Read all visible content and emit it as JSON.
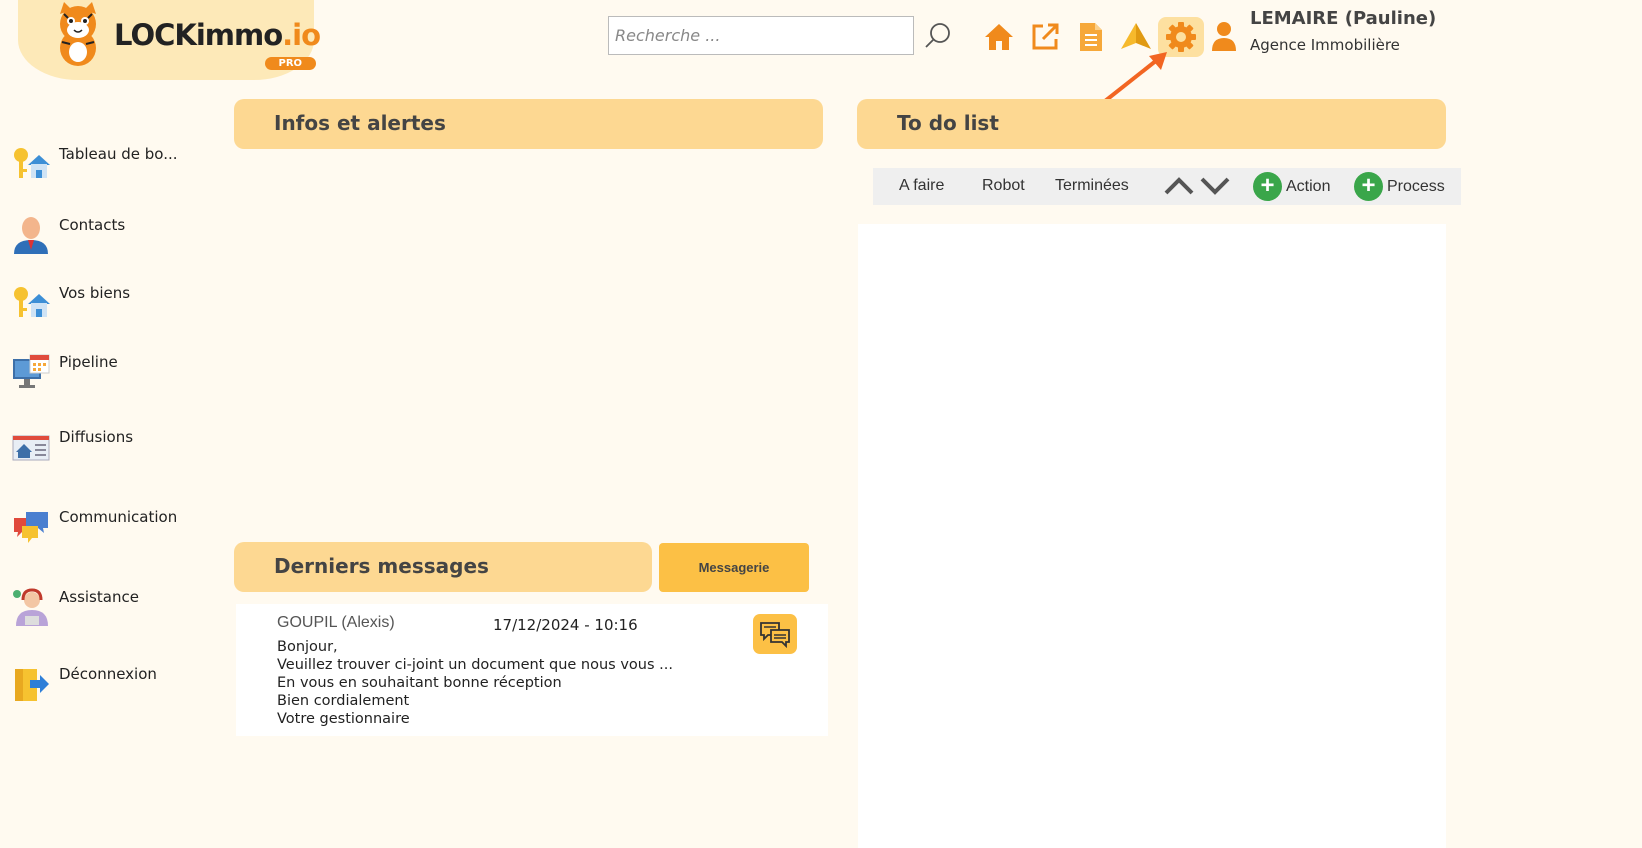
{
  "brand": {
    "name_main": "LOCKimmo",
    "name_suffix": ".io",
    "badge": "PRO"
  },
  "search": {
    "placeholder": "Recherche ..."
  },
  "header": {
    "icons": [
      "home-icon",
      "external-link-icon",
      "document-icon",
      "paper-plane-icon",
      "gear-icon",
      "user-icon"
    ],
    "active_icon": "gear-icon",
    "user_name": "LEMAIRE (Pauline)",
    "user_role": "Agence Immobilière"
  },
  "sidebar": {
    "items": [
      {
        "label": "Tableau de bo...",
        "icon": "keys-house-icon"
      },
      {
        "label": "Contacts",
        "icon": "person-icon"
      },
      {
        "label": "Vos biens",
        "icon": "keys-house-icon"
      },
      {
        "label": "Pipeline",
        "icon": "monitor-calendar-icon"
      },
      {
        "label": "Diffusions",
        "icon": "newspaper-icon"
      },
      {
        "label": "Communication",
        "icon": "chat-bubbles-icon"
      },
      {
        "label": "Assistance",
        "icon": "support-agent-icon"
      },
      {
        "label": "Déconnexion",
        "icon": "logout-door-icon"
      }
    ]
  },
  "infos": {
    "title": "Infos et alertes"
  },
  "messages": {
    "title": "Derniers messages",
    "button": "Messagerie",
    "items": [
      {
        "from": "GOUPIL (Alexis)",
        "date": "17/12/2024 - 10:16",
        "lines": [
          "Bonjour,",
          "Veuillez trouver ci-joint un document que nous vous ...",
          "En vous en souhaitant bonne réception",
          "Bien cordialement",
          "Votre gestionnaire"
        ]
      }
    ]
  },
  "todo": {
    "title": "To do list",
    "tabs": [
      "A faire",
      "Robot",
      "Terminées"
    ],
    "add_action": "Action",
    "add_process": "Process"
  },
  "colors": {
    "background": "#fffaf0",
    "panel_header": "#fdd892",
    "accent_orange": "#f08a1c",
    "button_yellow": "#fcc045",
    "green": "#3aa64a",
    "annotation_arrow": "#f26522"
  }
}
